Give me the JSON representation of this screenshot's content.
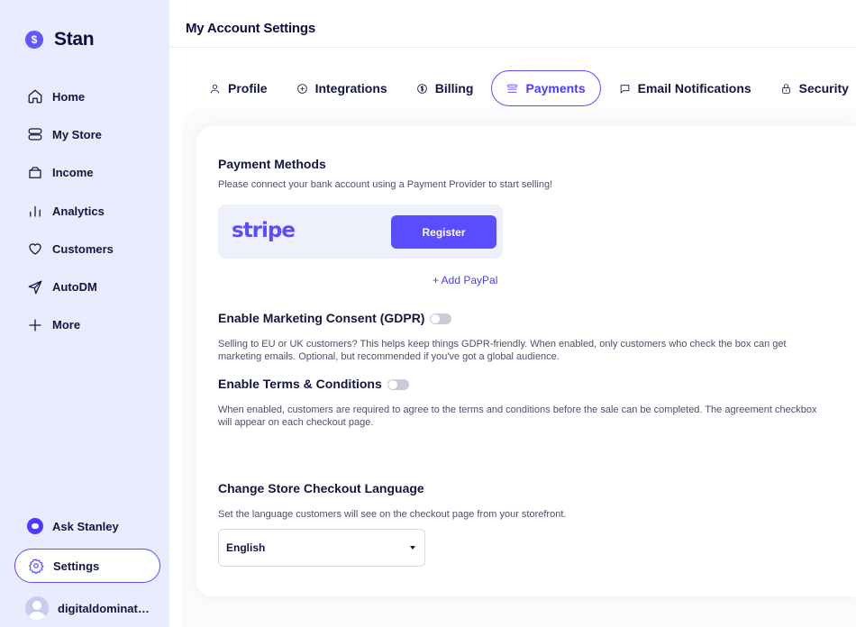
{
  "brand": {
    "logo_glyph": "$",
    "name": "Stan"
  },
  "sidebar": {
    "items": [
      {
        "label": "Home",
        "icon": "home-icon"
      },
      {
        "label": "My Store",
        "icon": "store-icon"
      },
      {
        "label": "Income",
        "icon": "wallet-icon"
      },
      {
        "label": "Analytics",
        "icon": "bar-chart-icon"
      },
      {
        "label": "Customers",
        "icon": "heart-icon"
      },
      {
        "label": "AutoDM",
        "icon": "send-icon"
      },
      {
        "label": "More",
        "icon": "plus-icon"
      }
    ],
    "ask": "Ask Stanley",
    "settings": "Settings",
    "user": "digitaldominat…"
  },
  "header": {
    "title": "My Account Settings"
  },
  "tabs": [
    {
      "label": "Profile",
      "icon": "user-icon",
      "active": false
    },
    {
      "label": "Integrations",
      "icon": "plus-circle-icon",
      "active": false
    },
    {
      "label": "Billing",
      "icon": "dollar-circle-icon",
      "active": false
    },
    {
      "label": "Payments",
      "icon": "list-icon",
      "active": true
    },
    {
      "label": "Email Notifications",
      "icon": "message-icon",
      "active": false
    },
    {
      "label": "Security",
      "icon": "lock-icon",
      "active": false
    }
  ],
  "payments": {
    "methods_title": "Payment Methods",
    "methods_desc": "Please connect your bank account using a Payment Provider to start selling!",
    "stripe_logo": "stripe",
    "register": "Register",
    "add_paypal": "+ Add PayPal",
    "gdpr_title": "Enable Marketing Consent (GDPR)",
    "gdpr_desc": "Selling to EU or UK customers? This helps keep things GDPR-friendly. When enabled, only customers who check the box can get marketing emails. Optional, but recommended if you've got a global audience.",
    "terms_title": "Enable Terms & Conditions",
    "terms_desc": "When enabled, customers are required to agree to the terms and conditions before the sale can be completed. The agreement checkbox will appear on each checkout page.",
    "lang_title": "Change Store Checkout Language",
    "lang_desc": "Set the language customers will see on the checkout page from your storefront.",
    "lang_value": "English"
  },
  "colors": {
    "accent": "#5a4cff",
    "sidebar_bg": "#e9ebfe",
    "text": "#131640"
  }
}
